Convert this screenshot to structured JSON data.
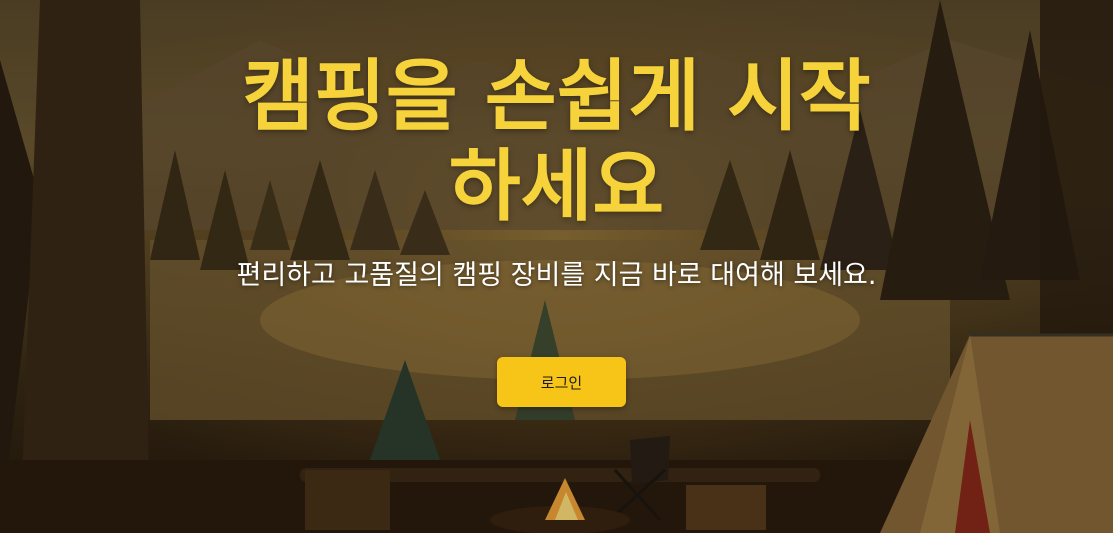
{
  "hero": {
    "headline_line1": "캠핑을 손쉽게 시작",
    "headline_line2": "하세요",
    "subtitle": "편리하고 고품질의 캠핑 장비를 지금 바로 대여해 보세요.",
    "login_label": "로그인"
  },
  "colors": {
    "headline": "#f6d33a",
    "button_bg": "#f7c518",
    "subtitle": "#ffffff"
  }
}
